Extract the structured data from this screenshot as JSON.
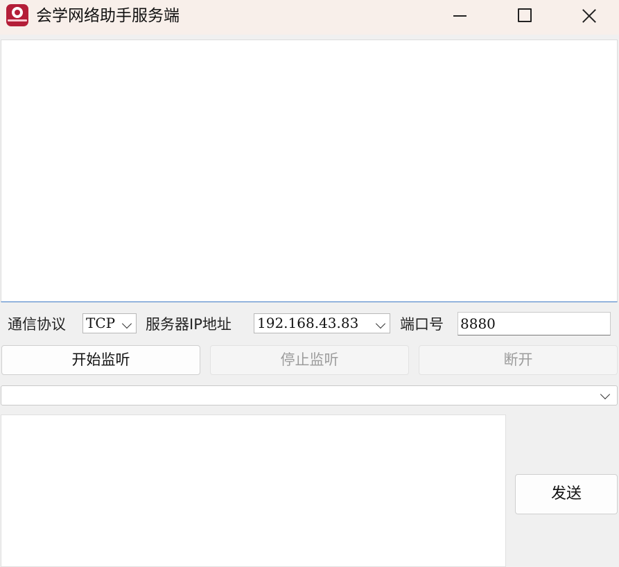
{
  "window": {
    "title": "会学网络助手服务端",
    "icon": "app-logo-icon",
    "controls": {
      "minimize": "minimize-icon",
      "maximize": "maximize-icon",
      "close": "close-icon"
    }
  },
  "receive_area": {
    "value": ""
  },
  "settings": {
    "protocol_label": "通信协议",
    "protocol_value": "TCP",
    "server_ip_label": "服务器IP地址",
    "server_ip_value": "192.168.43.83",
    "port_label": "端口号",
    "port_value": "8880"
  },
  "actions": {
    "start_label": "开始监听",
    "stop_label": "停止监听",
    "disconnect_label": "断开"
  },
  "client_select": {
    "value": ""
  },
  "send": {
    "message_value": "",
    "button_label": "发送"
  },
  "colors": {
    "titlebar": "#f8efea",
    "background": "#f0f0f0",
    "app_icon": "#b41e38",
    "focus_border": "#3b78c4"
  }
}
